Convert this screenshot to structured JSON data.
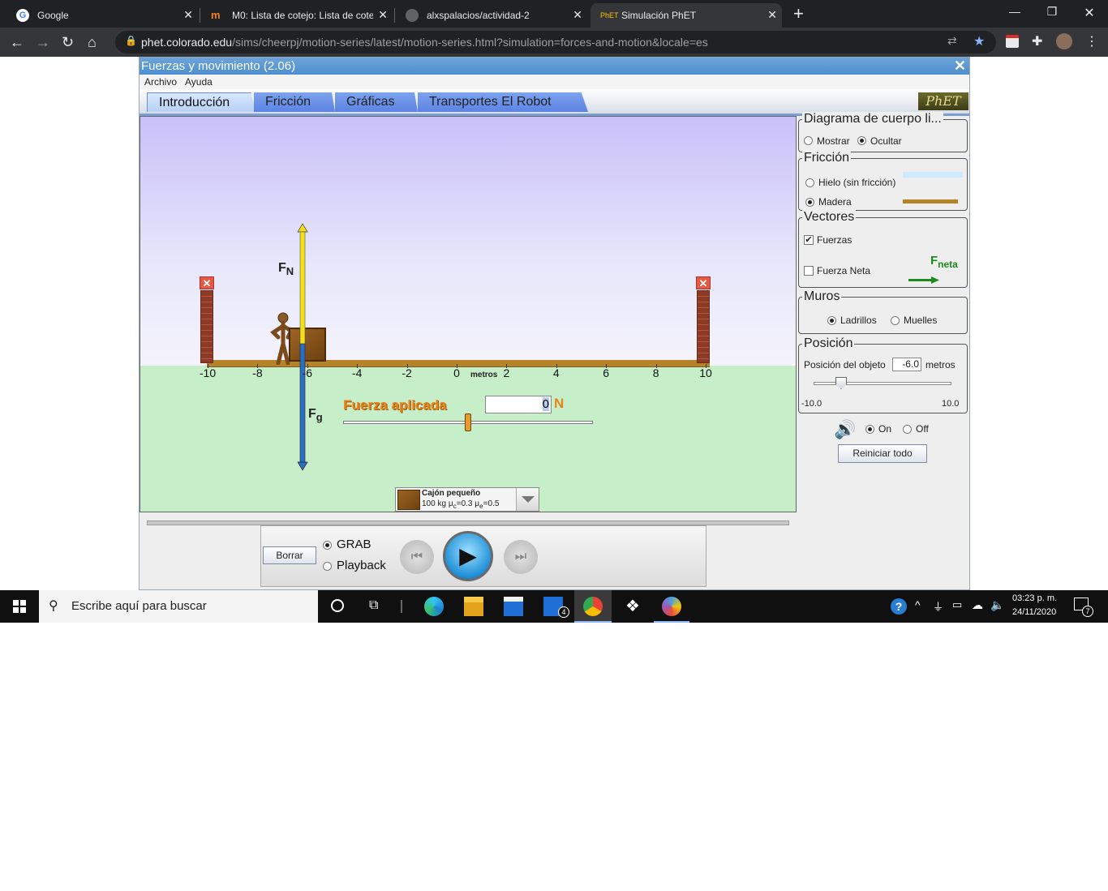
{
  "browser": {
    "tabs": [
      {
        "title": "Google"
      },
      {
        "title": "M0: Lista de cotejo: Lista de cotej"
      },
      {
        "title": "alxspalacios/actividad-2"
      },
      {
        "title": "Simulación PhET"
      }
    ],
    "url_host": "phet.colorado.edu",
    "url_path": "/sims/cheerpj/motion-series/latest/motion-series.html?simulation=forces-and-motion&locale=es"
  },
  "app": {
    "title": "Fuerzas y movimiento (2.06)",
    "menu": [
      "Archivo",
      "Ayuda"
    ],
    "tabs": [
      "Introducción",
      "Fricción",
      "Gráficas",
      "Transportes El Robot"
    ],
    "logo": "PhET"
  },
  "play": {
    "axis_ticks": [
      "-10",
      "-8",
      "-6",
      "-4",
      "-2",
      "0",
      "2",
      "4",
      "6",
      "8",
      "10"
    ],
    "axis_unit": "metros",
    "fn_label": "F",
    "fn_sub": "N",
    "fg_label": "F",
    "fg_sub": "g",
    "applied_force_label": "Fuerza aplicada",
    "applied_force_value": "0",
    "applied_force_unit": "N",
    "applied_force_slider_fraction": 0.5,
    "object_name": "Cajón pequeño",
    "object_mass": "100 kg",
    "mu_c": "=0.3",
    "mu_e": "=0.5",
    "mu_symbol": "μ",
    "mu_c_sub": "c",
    "mu_e_sub": "e"
  },
  "panel": {
    "fbd": {
      "title": "Diagrama de cuerpo li...",
      "show": "Mostrar",
      "hide": "Ocultar",
      "selected": "Ocultar"
    },
    "friction": {
      "title": "Fricción",
      "ice": "Hielo (sin fricción)",
      "wood": "Madera",
      "selected": "Madera"
    },
    "vectors": {
      "title": "Vectores",
      "forces": "Fuerzas",
      "forces_checked": true,
      "net": "Fuerza Neta",
      "net_checked": false,
      "fnet_label": "F",
      "fnet_sub": "neta"
    },
    "walls": {
      "title": "Muros",
      "bricks": "Ladrillos",
      "springs": "Muelles",
      "selected": "Ladrillos"
    },
    "position": {
      "title": "Posición",
      "label": "Posición del objeto",
      "value": "-6.0",
      "unit": "metros",
      "min": "-10.0",
      "max": "10.0",
      "slider_fraction": 0.2
    },
    "sound": {
      "on": "On",
      "off": "Off",
      "selected": "On"
    },
    "reset": "Reiniciar todo"
  },
  "playback": {
    "clear": "Borrar",
    "grab": "GRAB",
    "playback": "Playback",
    "selected": "GRAB"
  },
  "taskbar": {
    "search_placeholder": "Escribe aquí para buscar",
    "mail_badge": "4",
    "time": "03:23 p. m.",
    "date": "24/11/2020",
    "notifications": "7"
  },
  "colors": {
    "chrome_dark": "#202124",
    "phet_title": "#4f8fce",
    "applied_force": "#e8841a",
    "fn_arrow": "#f5e016",
    "fg_arrow": "#2b6fc4",
    "floor": "#b5842a"
  }
}
